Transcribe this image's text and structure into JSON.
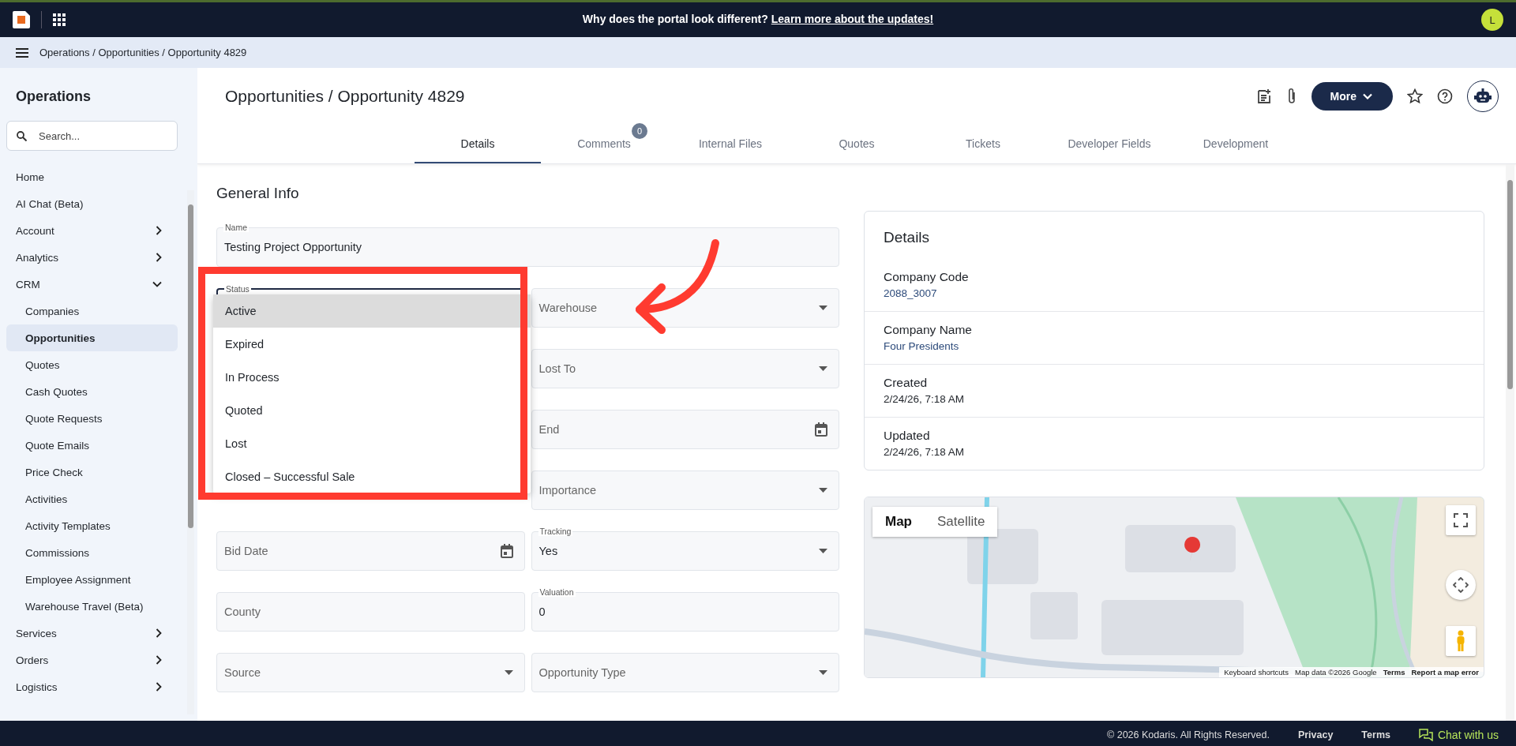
{
  "top_bar": {
    "banner": "Why does the portal look different?",
    "banner_link": "Learn more about the updates!",
    "avatar": "L"
  },
  "breadcrumb": "Operations / Opportunities / Opportunity 4829",
  "sidebar": {
    "title": "Operations",
    "search_placeholder": "Search...",
    "items": [
      {
        "label": "Home",
        "selected": false
      },
      {
        "label": "AI Chat (Beta)",
        "selected": false
      },
      {
        "label": "Account",
        "selected": false,
        "expanded": false
      },
      {
        "label": "Analytics",
        "selected": false,
        "expanded": false
      },
      {
        "label": "CRM",
        "selected": false,
        "expanded": true,
        "children": [
          {
            "label": "Companies",
            "selected": false
          },
          {
            "label": "Opportunities",
            "selected": true
          },
          {
            "label": "Quotes",
            "selected": false
          },
          {
            "label": "Cash Quotes",
            "selected": false
          },
          {
            "label": "Quote Requests",
            "selected": false
          },
          {
            "label": "Quote Emails",
            "selected": false
          },
          {
            "label": "Price Check",
            "selected": false
          },
          {
            "label": "Activities",
            "selected": false
          },
          {
            "label": "Activity Templates",
            "selected": false
          },
          {
            "label": "Commissions",
            "selected": false
          },
          {
            "label": "Employee Assignment",
            "selected": false
          },
          {
            "label": "Warehouse Travel (Beta)",
            "selected": false
          }
        ]
      },
      {
        "label": "Services",
        "selected": false,
        "expanded": false
      },
      {
        "label": "Orders",
        "selected": false,
        "expanded": false
      },
      {
        "label": "Logistics",
        "selected": false,
        "expanded": false
      }
    ]
  },
  "page_title": "Opportunities / Opportunity 4829",
  "more_button": "More",
  "tabs": [
    {
      "label": "Details",
      "selected": true
    },
    {
      "label": "Comments",
      "selected": false,
      "badge": "0"
    },
    {
      "label": "Internal Files",
      "selected": false
    },
    {
      "label": "Quotes",
      "selected": false
    },
    {
      "label": "Tickets",
      "selected": false
    },
    {
      "label": "Developer Fields",
      "selected": false
    },
    {
      "label": "Development",
      "selected": false
    }
  ],
  "form": {
    "title": "General Info",
    "name": {
      "label": "Name",
      "value": "Testing Project Opportunity"
    },
    "status": {
      "label": "Status",
      "open": true,
      "options": [
        {
          "label": "Active",
          "selected": true
        },
        {
          "label": "Expired",
          "selected": false
        },
        {
          "label": "In Process",
          "selected": false
        },
        {
          "label": "Quoted",
          "selected": false
        },
        {
          "label": "Lost",
          "selected": false
        },
        {
          "label": "Closed – Successful Sale",
          "selected": false
        }
      ]
    },
    "rows": [
      {
        "right": {
          "label": "Warehouse",
          "kind": "select"
        }
      },
      {
        "right": {
          "label": "Lost To",
          "kind": "select"
        }
      },
      {
        "right": {
          "label": "End",
          "kind": "date"
        }
      },
      {
        "right": {
          "label": "Importance",
          "kind": "select"
        }
      },
      {
        "left": {
          "label": "Bid Date",
          "kind": "date"
        },
        "right": {
          "label": "Tracking",
          "value": "Yes",
          "kind": "select"
        }
      },
      {
        "left": {
          "label": "County",
          "kind": "text"
        },
        "right": {
          "label": "Valuation",
          "value": "0",
          "kind": "text"
        }
      },
      {
        "left": {
          "label": "Source",
          "kind": "select"
        },
        "right": {
          "label": "Opportunity Type",
          "kind": "select"
        }
      }
    ]
  },
  "details": {
    "title": "Details",
    "rows": [
      {
        "label": "Company Code",
        "value": "2088_3007",
        "kind": "link"
      },
      {
        "label": "Company Name",
        "value": "Four Presidents",
        "kind": "link"
      },
      {
        "label": "Created",
        "value": "2/24/26, 7:18 AM",
        "kind": "text"
      },
      {
        "label": "Updated",
        "value": "2/24/26, 7:18 AM",
        "kind": "text"
      }
    ]
  },
  "map": {
    "kind": "picture",
    "map_types": [
      {
        "label": "Map",
        "selected": true
      },
      {
        "label": "Satellite",
        "selected": false
      }
    ],
    "attribution": [
      "Keyboard shortcuts",
      "Map data ©2026 Google",
      "Terms",
      "Report a map error"
    ]
  },
  "footer": {
    "copyright": "© 2026 Kodaris. All Rights Reserved.",
    "links": [
      "Privacy",
      "Terms"
    ],
    "chat": "Chat with us"
  }
}
